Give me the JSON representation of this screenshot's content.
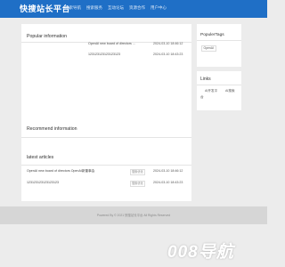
{
  "header": {
    "logo": "快搜站长平台",
    "nav": [
      "搜索导航",
      "搜索服务",
      "互动论坛",
      "资源合作",
      "用户中心"
    ]
  },
  "popular": {
    "title": "Popular information",
    "items": [
      {
        "title": "OpenAI new board of directors ...",
        "date": "2024-03-10 18:46:12"
      },
      {
        "title": "123123123123123123",
        "date": "2024-03-10 18:43:23"
      }
    ]
  },
  "recommend": {
    "title": "Recommend information"
  },
  "latest": {
    "title": "latest articles",
    "items": [
      {
        "title": "OpenAI new board of directors OpenAI新董事会",
        "tag": "搜索优化",
        "date": "2024-03-10 18:46:12"
      },
      {
        "title": "123123123123123123",
        "tag": "搜索优化",
        "date": "2024-03-10 18:43:23"
      }
    ]
  },
  "sidebar": {
    "tags_title": "PopulerTags",
    "tags": [
      "OpenAI"
    ],
    "links_title": "Links",
    "links": [
      "AI开发平",
      "AI搜索",
      "台"
    ]
  },
  "footer": {
    "text": "Powered By © 2021 快搜站长平台 All Rights Reserved"
  },
  "watermark": "008导航"
}
